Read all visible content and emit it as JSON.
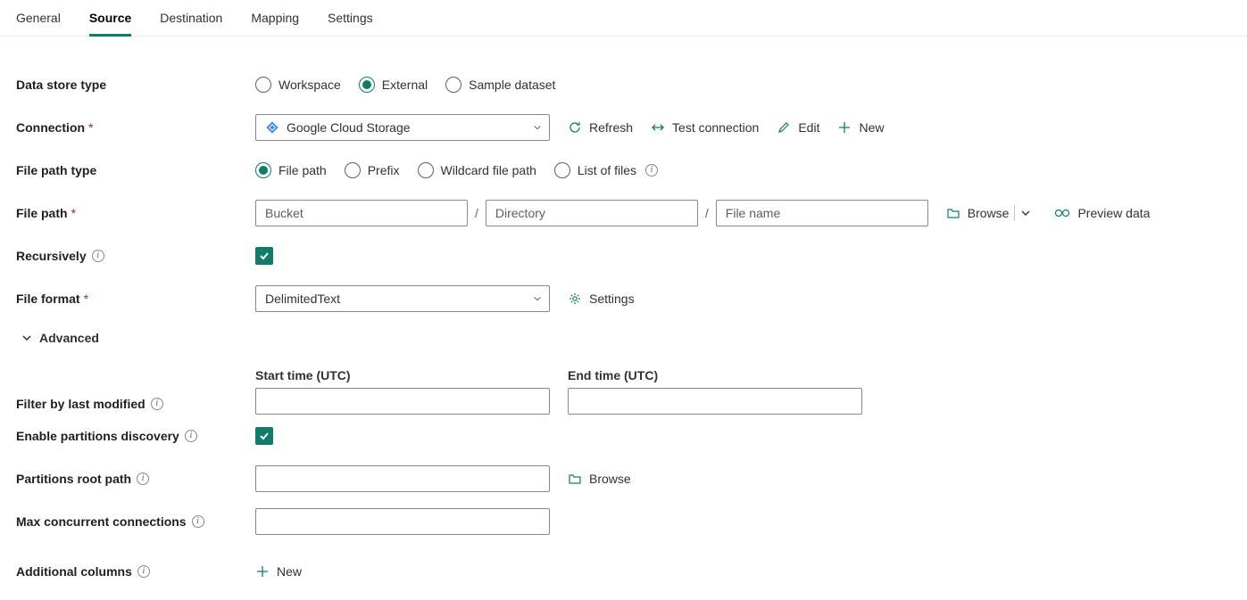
{
  "tabs": {
    "general": "General",
    "source": "Source",
    "destination": "Destination",
    "mapping": "Mapping",
    "settings": "Settings"
  },
  "labels": {
    "data_store_type": "Data store type",
    "connection": "Connection",
    "file_path_type": "File path type",
    "file_path": "File path",
    "recursively": "Recursively",
    "file_format": "File format",
    "advanced": "Advanced",
    "filter_by_last_modified": "Filter by last modified",
    "start_time": "Start time (UTC)",
    "end_time": "End time (UTC)",
    "enable_partitions_discovery": "Enable partitions discovery",
    "partitions_root_path": "Partitions root path",
    "max_concurrent_connections": "Max concurrent connections",
    "additional_columns": "Additional columns"
  },
  "data_store_type": {
    "workspace": "Workspace",
    "external": "External",
    "sample_dataset": "Sample dataset",
    "selected": "external"
  },
  "connection": {
    "value": "Google Cloud Storage",
    "actions": {
      "refresh": "Refresh",
      "test": "Test connection",
      "edit": "Edit",
      "new": "New"
    }
  },
  "file_path_type": {
    "file_path": "File path",
    "prefix": "Prefix",
    "wildcard": "Wildcard file path",
    "list_of_files": "List of files",
    "selected": "file_path"
  },
  "file_path": {
    "bucket_placeholder": "Bucket",
    "directory_placeholder": "Directory",
    "file_name_placeholder": "File name",
    "browse": "Browse",
    "preview": "Preview data"
  },
  "file_format": {
    "value": "DelimitedText",
    "settings": "Settings"
  },
  "partitions": {
    "browse": "Browse"
  },
  "additional_columns": {
    "new": "New"
  }
}
